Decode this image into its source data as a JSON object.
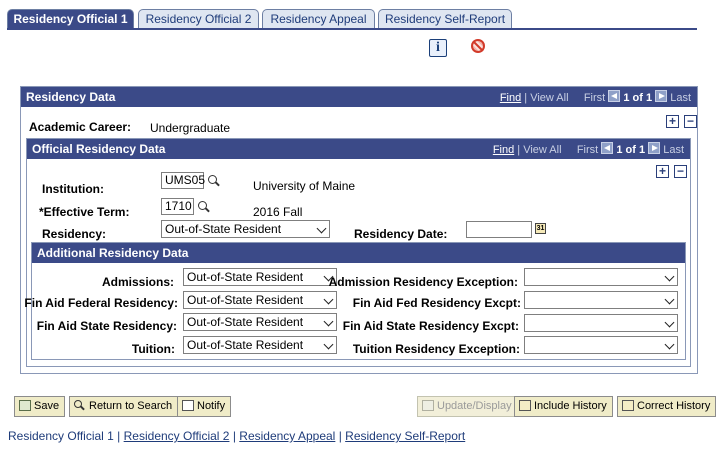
{
  "tabs": [
    {
      "label": "Residency Official 1"
    },
    {
      "label": "Residency Official 2"
    },
    {
      "label": "Residency Appeal"
    },
    {
      "label": "Residency Self-Report"
    }
  ],
  "residency_data": {
    "title": "Residency Data",
    "find": "Find",
    "sep": "|",
    "view_all": "View All",
    "first": "First",
    "pager": "1 of 1",
    "last": "Last",
    "academic_career_label": "Academic Career:",
    "academic_career_value": "Undergraduate"
  },
  "official": {
    "title": "Official Residency Data",
    "find": "Find",
    "sep": "|",
    "view_all": "View All",
    "first": "First",
    "pager": "1 of 1",
    "last": "Last",
    "institution_label": "Institution:",
    "institution_value": "UMS05",
    "institution_desc": "University of Maine",
    "term_label": "*Effective Term:",
    "term_value": "1710",
    "term_desc": "2016 Fall",
    "residency_label": "Residency:",
    "residency_value": "Out-of-State Resident",
    "residency_date_label": "Residency Date:",
    "residency_date_value": ""
  },
  "additional": {
    "title": "Additional Residency Data",
    "admissions_label": "Admissions:",
    "admissions_value": "Out-of-State Resident",
    "fa_federal_label": "Fin Aid Federal Residency:",
    "fa_federal_value": "Out-of-State Resident",
    "fa_state_label": "Fin Aid State Residency:",
    "fa_state_value": "Out-of-State Resident",
    "tuition_label": "Tuition:",
    "tuition_value": "Out-of-State Resident",
    "adm_exc_label": "Admission Residency Exception:",
    "fed_exc_label": "Fin Aid Fed Residency Excpt:",
    "state_exc_label": "Fin Aid State Residency Excpt:",
    "tuition_exc_label": "Tuition Residency Exception:"
  },
  "toolbar": {
    "save": "Save",
    "return_to_search": "Return to Search",
    "notify": "Notify",
    "update_display": "Update/Display",
    "include_history": "Include History",
    "correct_history": "Correct History"
  },
  "footer": {
    "links": [
      "Residency Official 1",
      "Residency Official 2",
      "Residency Appeal",
      "Residency Self-Report"
    ],
    "sep": "|"
  }
}
